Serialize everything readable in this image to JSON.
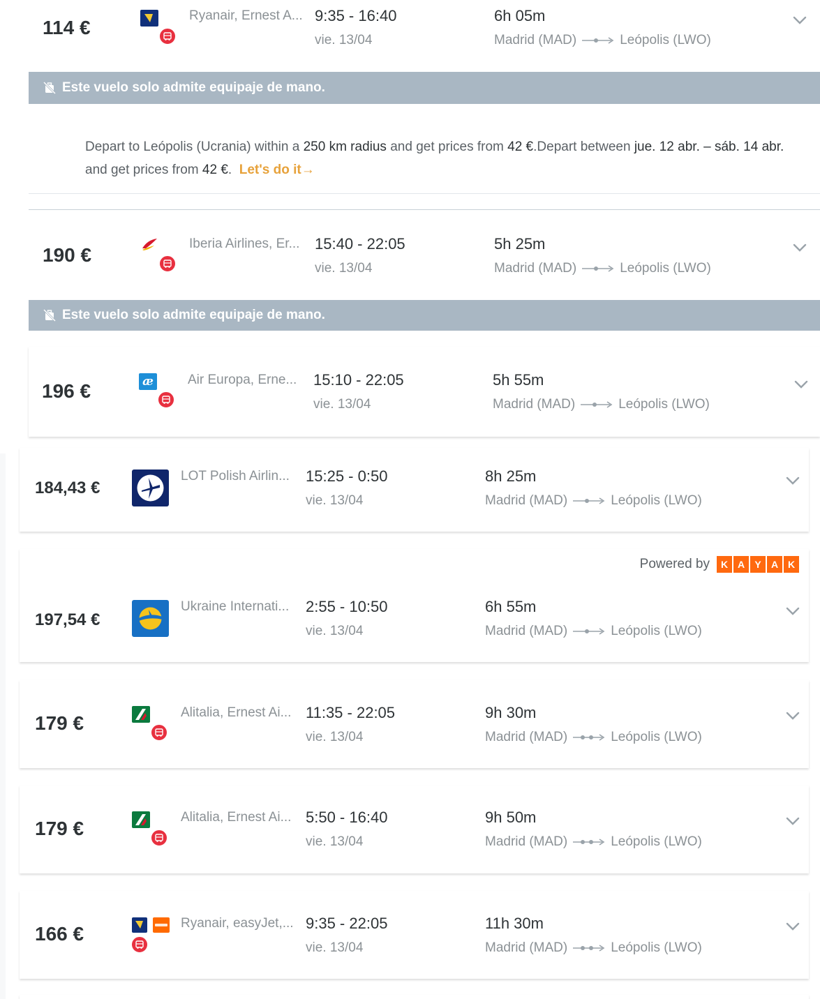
{
  "colors": {
    "warning_bar": "#a9b7c3",
    "promo_link": "#e7a23b",
    "kayak_orange": "#ff690f",
    "badge_red": "#e8303f"
  },
  "warning_text": "Este vuelo solo admite equipaje de mano.",
  "promo": {
    "p1": "Depart to Leópolis (Ucrania) within a ",
    "b1": "250 km radius",
    "p2": " and get prices from ",
    "b2": "42 €",
    "p3": ".Depart between ",
    "b3": "jue. 12 abr. – sáb. 14 abr.",
    "p4": " and get prices from ",
    "b4": "42 €",
    "p5": ".",
    "link": "Let's do it→"
  },
  "powered_by": {
    "label": "Powered by",
    "brand_letters": [
      "K",
      "A",
      "Y",
      "A",
      "K"
    ]
  },
  "flights": [
    {
      "price": "114 €",
      "airline": "Ryanair, Ernest A...",
      "times": "9:35 - 16:40",
      "date": "vie. 13/04",
      "duration": "6h 05m",
      "origin": "Madrid (MAD)",
      "destination": "Leópolis (LWO)",
      "logo": "ryanair-logo"
    },
    {
      "price": "190 €",
      "airline": "Iberia Airlines, Er...",
      "times": "15:40 - 22:05",
      "date": "vie. 13/04",
      "duration": "5h 25m",
      "origin": "Madrid (MAD)",
      "destination": "Leópolis (LWO)",
      "logo": "iberia-logo"
    },
    {
      "price": "196 €",
      "airline": "Air Europa, Erne...",
      "times": "15:10 - 22:05",
      "date": "vie. 13/04",
      "duration": "5h 55m",
      "origin": "Madrid (MAD)",
      "destination": "Leópolis (LWO)",
      "logo": "aireuropa-logo"
    },
    {
      "price": "184,43 €",
      "airline": "LOT Polish Airlin...",
      "times": "15:25 - 0:50",
      "date": "vie. 13/04",
      "duration": "8h 25m",
      "origin": "Madrid (MAD)",
      "destination": "Leópolis (LWO)",
      "logo": "lot-logo"
    },
    {
      "price": "197,54 €",
      "airline": "Ukraine Internati...",
      "times": "2:55 - 10:50",
      "date": "vie. 13/04",
      "duration": "6h 55m",
      "origin": "Madrid (MAD)",
      "destination": "Leópolis (LWO)",
      "logo": "uia-logo"
    },
    {
      "price": "179 €",
      "airline": "Alitalia, Ernest Ai...",
      "times": "11:35 - 22:05",
      "date": "vie. 13/04",
      "duration": "9h 30m",
      "origin": "Madrid (MAD)",
      "destination": "Leópolis (LWO)",
      "logo": "alitalia-logo"
    },
    {
      "price": "179 €",
      "airline": "Alitalia, Ernest Ai...",
      "times": "5:50 - 16:40",
      "date": "vie. 13/04",
      "duration": "9h 50m",
      "origin": "Madrid (MAD)",
      "destination": "Leópolis (LWO)",
      "logo": "alitalia-logo"
    },
    {
      "price": "166 €",
      "airline": "Ryanair, easyJet,...",
      "times": "9:35 - 22:05",
      "date": "vie. 13/04",
      "duration": "11h 30m",
      "origin": "Madrid (MAD)",
      "destination": "Leópolis (LWO)",
      "logo": "ryanair-easyjet-logo"
    }
  ]
}
